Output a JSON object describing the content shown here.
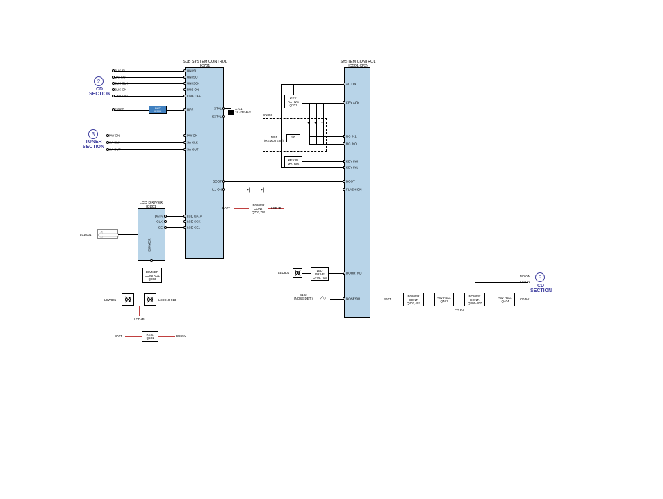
{
  "blocks": {
    "subSystem": {
      "title": "SUB SYSTEM CONTROL",
      "sub": "IC701"
    },
    "systemControl": {
      "title": "SYSTEM CONTROL",
      "sub": "IC501 (3/3)"
    },
    "lcdDriver": {
      "title": "LCD DRIVER",
      "sub": "IC801"
    },
    "buf": {
      "label": "BUF",
      "sub": "IC702"
    },
    "xtal": {
      "label": "X701",
      "freq": "18.432MHz"
    },
    "keyActive": {
      "l1": "KEY",
      "l2": "ACTIVE",
      "l3": "Q701"
    },
    "keyMatrix": {
      "l1": "KEY IN",
      "l2": "MATRIX"
    },
    "powerCont1": {
      "l1": "POWER",
      "l2": "CONT.",
      "l3": "Q703,705"
    },
    "dimmerControl": {
      "l1": "DIMMER",
      "l2": "CONTROL",
      "l3": "Q803"
    },
    "ledDrive": {
      "l1": "LED",
      "l2": "DRIVE",
      "l3": "Q705,706"
    },
    "reg": {
      "l1": "REG.",
      "l2": "Q501"
    },
    "powerCont2": {
      "l1": "POWER",
      "l2": "CONT.",
      "l3": "Q402,403"
    },
    "reg8v": {
      "l1": "+8V REG.",
      "l2": "Q401"
    },
    "powerCont3": {
      "l1": "POWER",
      "l2": "CONT.",
      "l3": "Q405-407"
    },
    "reg5v": {
      "l1": "+5V REG.",
      "l2": "Q404"
    },
    "j801": {
      "l1": "J801",
      "l2": "(REMOTE IN)"
    },
    "cn850": "CN850",
    "s102": {
      "l1": "S102",
      "l2": "(NOSE DET.)"
    }
  },
  "sections": {
    "cd2": {
      "num": "2",
      "l1": "CD",
      "l2": "SECTION"
    },
    "tuner": {
      "num": "3",
      "l1": "TUNER",
      "l2": "SECTION"
    },
    "cd5": {
      "num": "5",
      "l1": "CD",
      "l2": "SECTION"
    }
  },
  "pins": {
    "left1": [
      "BUS SI",
      "UNI SO",
      "BUS CLK",
      "BUS ON",
      "LINK OFF"
    ],
    "right1": [
      "UNI SI",
      "UNI SO",
      "UNI SCK",
      "BUS ON",
      "LINK OFF"
    ],
    "srst": "S RST",
    "res": "RES",
    "xtal": "XTAL",
    "extal": "EXTAL",
    "left2": [
      "PW ON",
      "SA CLK",
      "SA OUT"
    ],
    "right2": [
      "PW ON",
      "SA CLK",
      "SA OUT"
    ],
    "lcd_l": [
      "DATA",
      "CLK",
      "CE"
    ],
    "lcd_r": [
      "LCD DATA",
      "LCD SCK",
      "LCD CE1"
    ],
    "dimmer": "DIMMER",
    "boot": "BOOT",
    "illon": "ILL ON",
    "sys_l": [
      "AD ON",
      "KEY ACK",
      "RC IN1",
      "RC IN0",
      "KEY IN0",
      "KEY IN1",
      "BOOT",
      "FLASH ON",
      "DOOR IND",
      "NOSESW"
    ]
  },
  "signals": {
    "lcd001": "LCD001",
    "lsw801": "LSW801",
    "led910": "LED910-913",
    "lcdb1": "LCD+B",
    "lcdb2": "LCD+B",
    "batt1": "BATT",
    "batt2": "BATT",
    "batt3": "BATT",
    "bus5v": "BUS5V",
    "led801": "LED801",
    "mdon": "MD ON",
    "cdon": "CD ON",
    "cd8v": "CD 8V",
    "cd5v": "CD 5V"
  }
}
